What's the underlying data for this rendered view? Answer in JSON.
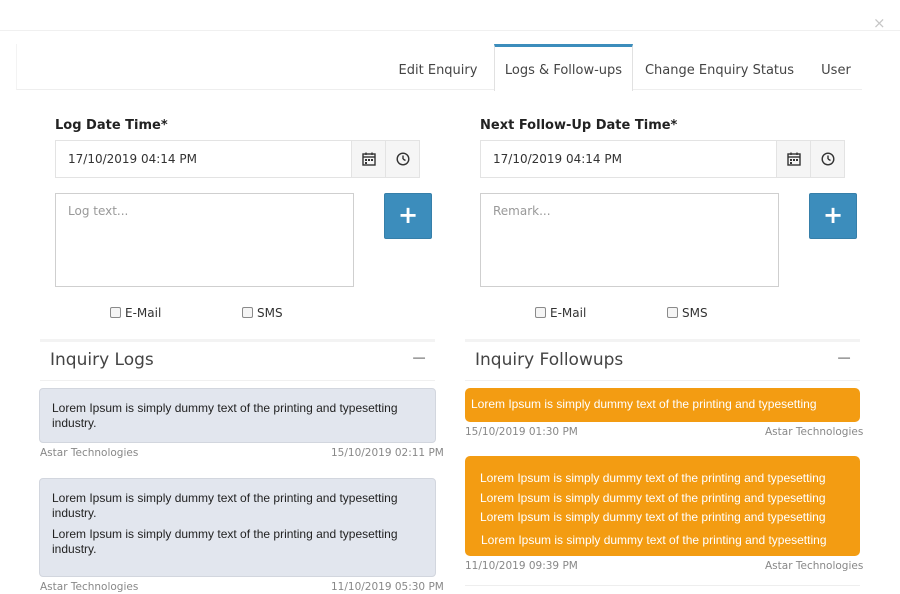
{
  "dialog": {
    "close_symbol": "×"
  },
  "tabs": [
    {
      "label": "Edit Enquiry",
      "active": false
    },
    {
      "label": "Logs & Follow-ups",
      "active": true
    },
    {
      "label": "Change Enquiry Status",
      "active": false
    },
    {
      "label": "User",
      "active": false
    }
  ],
  "log_form": {
    "label": "Log Date Time*",
    "datetime_value": "17/10/2019 04:14 PM",
    "textarea_placeholder": "Log text...",
    "add_symbol": "+",
    "email_label": "E-Mail",
    "sms_label": "SMS"
  },
  "followup_form": {
    "label": "Next Follow-Up Date Time*",
    "datetime_value": "17/10/2019 04:14 PM",
    "textarea_placeholder": "Remark...",
    "add_symbol": "+",
    "email_label": "E-Mail",
    "sms_label": "SMS"
  },
  "inquiry_logs": {
    "title": "Inquiry Logs",
    "collapse_symbol": "−",
    "items": [
      {
        "lines": [
          "Lorem Ipsum is simply dummy text of the printing and typesetting industry."
        ],
        "author": "Astar Technologies",
        "timestamp": "15/10/2019 02:11 PM"
      },
      {
        "lines": [
          "Lorem Ipsum is simply dummy text of the printing and typesetting industry.",
          "Lorem Ipsum is simply dummy text of the printing and typesetting industry."
        ],
        "author": "Astar Technologies",
        "timestamp": "11/10/2019 05:30 PM"
      }
    ]
  },
  "inquiry_followups": {
    "title": "Inquiry Followups",
    "collapse_symbol": "−",
    "items": [
      {
        "lines": [
          "Lorem Ipsum is simply dummy text of the printing and typesetting"
        ],
        "timestamp": "15/10/2019 01:30 PM",
        "author": "Astar Technologies"
      },
      {
        "lines": [
          "Lorem Ipsum is simply dummy text of the printing and typesetting",
          "Lorem Ipsum is simply dummy text of the printing and typesetting",
          "Lorem Ipsum is simply dummy text of the printing and typesetting",
          "Lorem Ipsum is simply dummy text of the printing and typesetting"
        ],
        "timestamp": "11/10/2019 09:39 PM",
        "author": "Astar Technologies"
      }
    ]
  },
  "colors": {
    "primary": "#3c8dbc",
    "followup_bubble": "#f39c12",
    "log_bubble": "#e2e6ee"
  },
  "icons": [
    "close-icon",
    "calendar-icon",
    "clock-icon",
    "plus-icon",
    "minus-icon",
    "checkbox-icon"
  ]
}
